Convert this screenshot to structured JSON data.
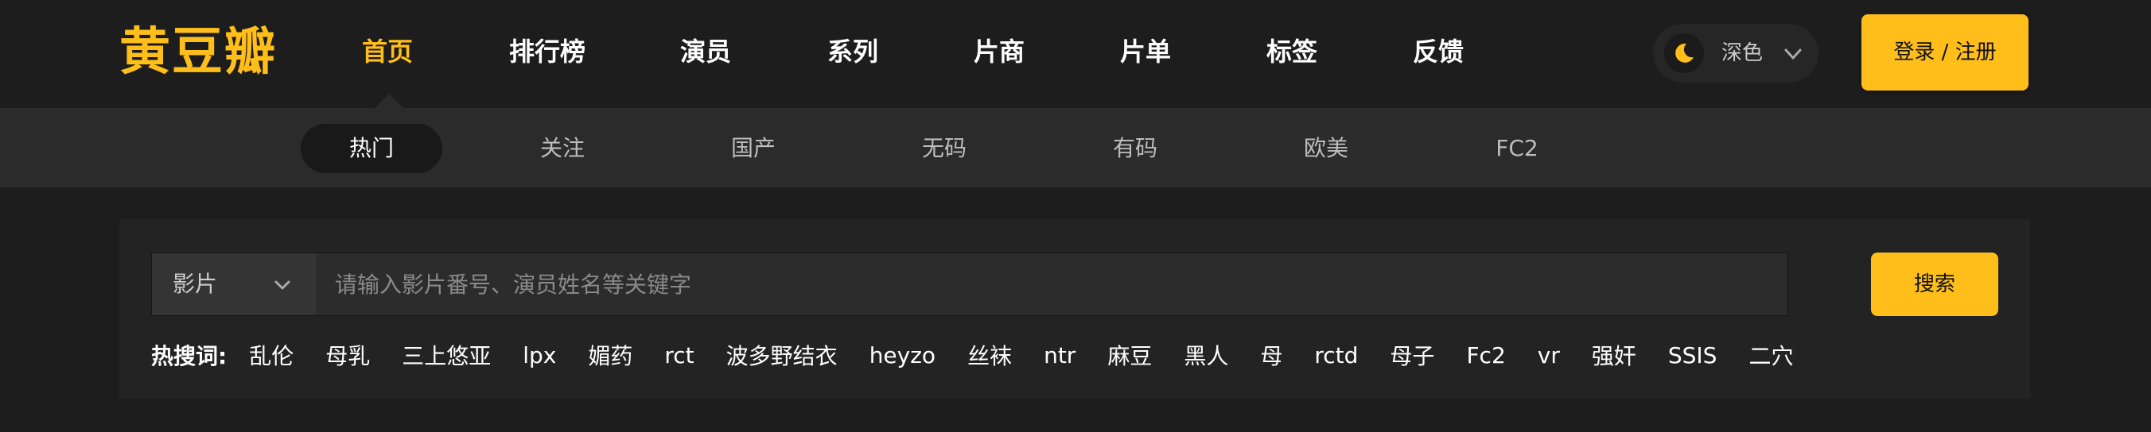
{
  "header": {
    "logo_text": "黄豆瓣",
    "nav": [
      {
        "label": "首页",
        "active": true
      },
      {
        "label": "排行榜"
      },
      {
        "label": "演员"
      },
      {
        "label": "系列"
      },
      {
        "label": "片商"
      },
      {
        "label": "片单"
      },
      {
        "label": "标签"
      },
      {
        "label": "反馈"
      }
    ],
    "theme": {
      "label": "深色",
      "icon": "moon-icon"
    },
    "login_label": "登录 / 注册"
  },
  "subnav": [
    {
      "label": "热门",
      "active": true
    },
    {
      "label": "关注"
    },
    {
      "label": "国产"
    },
    {
      "label": "无码"
    },
    {
      "label": "有码"
    },
    {
      "label": "欧美"
    },
    {
      "label": "FC2"
    }
  ],
  "search": {
    "type_selected": "影片",
    "placeholder": "请输入影片番号、演员姓名等关键字",
    "value": "",
    "button_label": "搜索"
  },
  "hot": {
    "label": "热搜词:",
    "tags": [
      "乱伦",
      "母乳",
      "三上悠亚",
      "lpx",
      "媚药",
      "rct",
      "波多野结衣",
      "heyzo",
      "丝袜",
      "ntr",
      "麻豆",
      "黑人",
      "母",
      "rctd",
      "母子",
      "Fc2",
      "vr",
      "强奸",
      "SSIS",
      "二穴"
    ]
  },
  "colors": {
    "accent": "#ffbe19",
    "background": "#1d1d1d",
    "subnav_bg": "#2b2b2b",
    "panel_bg": "#232323"
  }
}
